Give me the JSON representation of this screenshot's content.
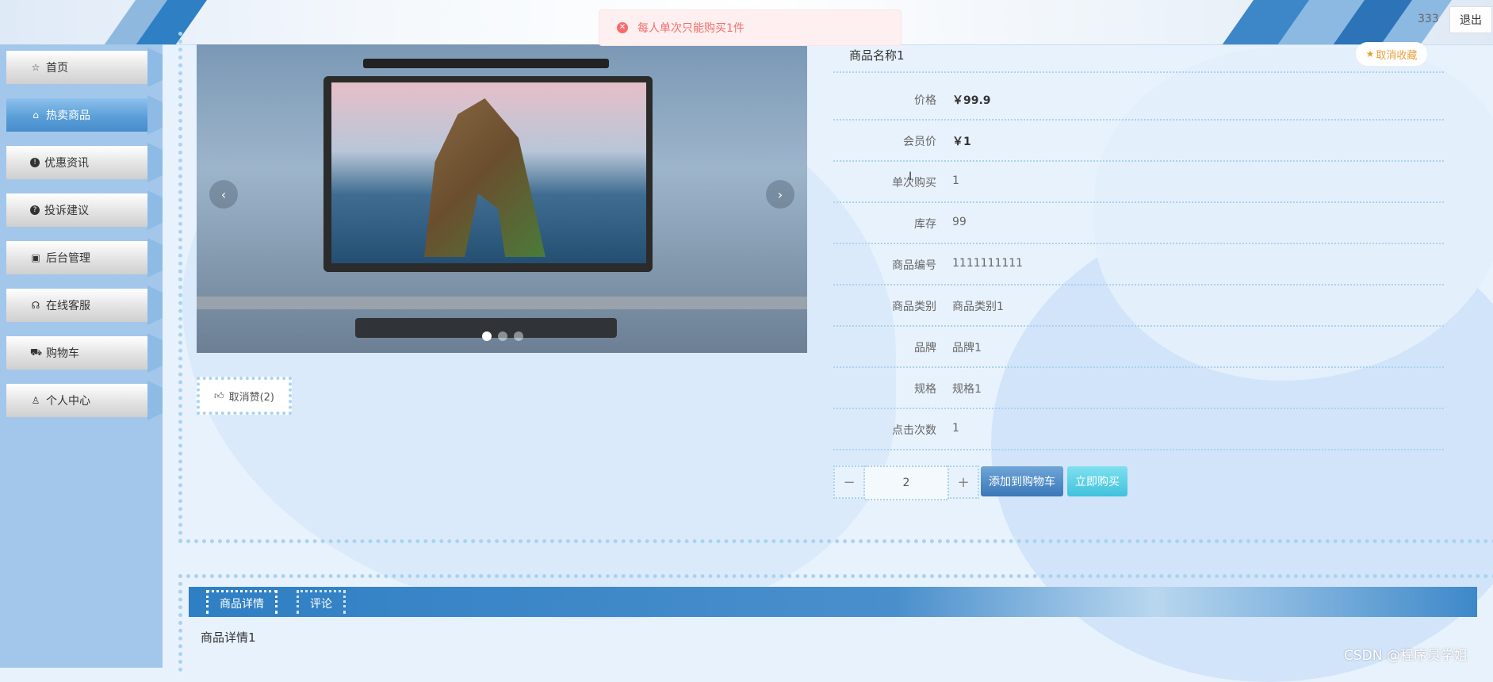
{
  "header": {
    "username": "333",
    "logout_label": "退出"
  },
  "toast": {
    "message": "每人单次只能购买1件",
    "type": "error"
  },
  "sidebar": {
    "items": [
      {
        "label": "首页",
        "icon": "star-icon"
      },
      {
        "label": "热卖商品",
        "icon": "bag-icon",
        "active": true
      },
      {
        "label": "优惠资讯",
        "icon": "alert-icon"
      },
      {
        "label": "投诉建议",
        "icon": "question-icon"
      },
      {
        "label": "后台管理",
        "icon": "briefcase-icon"
      },
      {
        "label": "在线客服",
        "icon": "headset-icon"
      },
      {
        "label": "购物车",
        "icon": "cart-icon"
      },
      {
        "label": "个人中心",
        "icon": "user-icon"
      }
    ]
  },
  "carousel": {
    "slide_count": 3,
    "active_slide": 1,
    "prev_icon": "chevron-left-icon",
    "next_icon": "chevron-right-icon"
  },
  "like": {
    "label": "取消赞(2)"
  },
  "product": {
    "name": "商品名称1",
    "favorite_label": "取消收藏",
    "fields": [
      {
        "label": "价格",
        "value": "￥99.9",
        "bold": true
      },
      {
        "label": "会员价",
        "value": "￥1",
        "bold": true
      },
      {
        "label": "单次购买",
        "value": "1"
      },
      {
        "label": "库存",
        "value": "99"
      },
      {
        "label": "商品编号",
        "value": "1111111111"
      },
      {
        "label": "商品类别",
        "value": "商品类别1"
      },
      {
        "label": "品牌",
        "value": "品牌1"
      },
      {
        "label": "规格",
        "value": "规格1"
      },
      {
        "label": "点击次数",
        "value": "1"
      }
    ]
  },
  "purchase": {
    "quantity": "2",
    "decrease_label": "−",
    "increase_label": "+",
    "add_to_cart_label": "添加到购物车",
    "buy_now_label": "立即购买"
  },
  "detail_tabs": {
    "tabs": [
      "商品详情",
      "评论"
    ],
    "active_tab": 0,
    "content": "商品详情1"
  },
  "watermark": "CSDN @程序员学姐",
  "colors": {
    "accent": "#2f7fc4",
    "error": "#f56c6c",
    "favorite": "#e6a23c",
    "buy": "#40c2dc"
  }
}
